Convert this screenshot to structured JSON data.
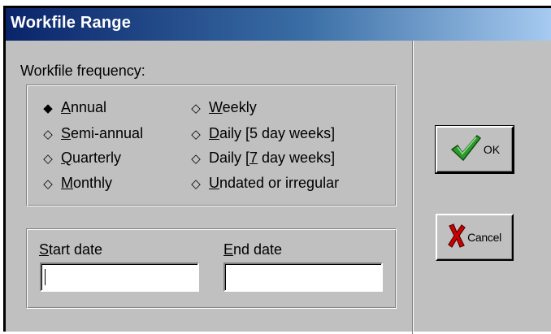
{
  "window": {
    "title": "Workfile Range"
  },
  "frequency": {
    "label": "Workfile frequency:",
    "options_left": [
      {
        "pre": "",
        "key": "A",
        "post": "nnual",
        "selected": true
      },
      {
        "pre": "",
        "key": "S",
        "post": "emi-annual",
        "selected": false
      },
      {
        "pre": "",
        "key": "Q",
        "post": "uarterly",
        "selected": false
      },
      {
        "pre": "",
        "key": "M",
        "post": "onthly",
        "selected": false
      }
    ],
    "options_right": [
      {
        "pre": "",
        "key": "W",
        "post": "eekly",
        "selected": false
      },
      {
        "pre": "",
        "key": "D",
        "post": "aily [5 day weeks]",
        "selected": false
      },
      {
        "pre": "Daily [",
        "key": "7",
        "post": " day weeks]",
        "selected": false
      },
      {
        "pre": "",
        "key": "U",
        "post": "ndated or irregular",
        "selected": false
      }
    ]
  },
  "dates": {
    "start_key": "S",
    "start_rest": "tart date",
    "start_value": "",
    "end_key": "E",
    "end_rest": "nd date",
    "end_value": ""
  },
  "buttons": {
    "ok": "OK",
    "cancel": "Cancel"
  },
  "colors": {
    "titlebar_start": "#0a246a",
    "titlebar_end": "#a6caf0",
    "face": "#c0c0c0",
    "check": "#2e9a2e",
    "cross": "#cc0000"
  }
}
